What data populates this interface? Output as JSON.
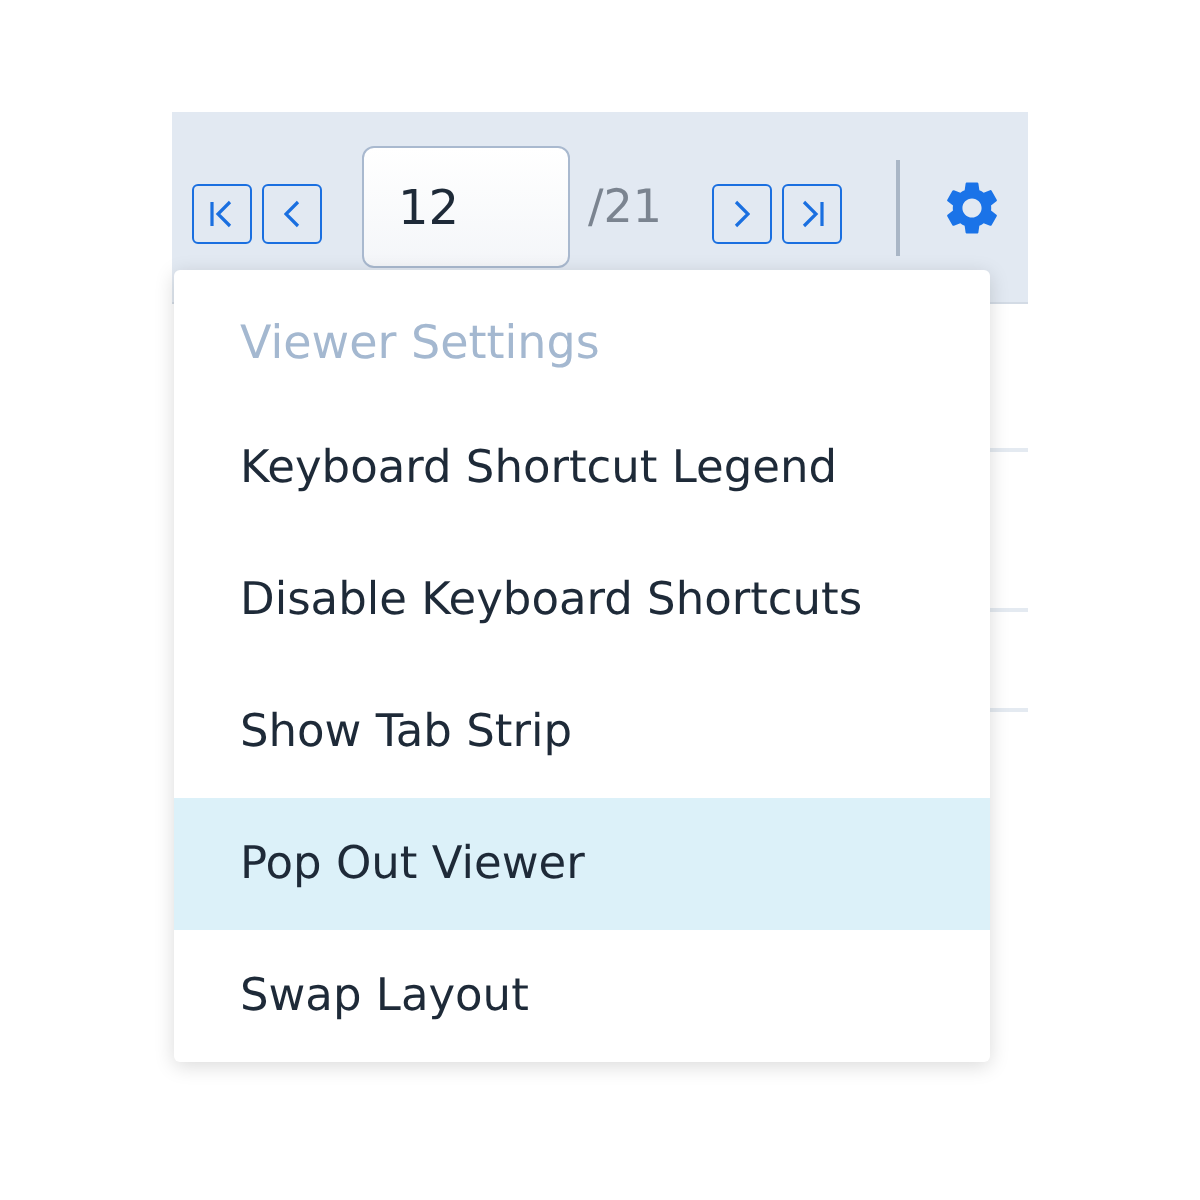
{
  "toolbar": {
    "page_number": "12",
    "page_total": "/21"
  },
  "settings_menu": {
    "header": "Viewer Settings",
    "items": [
      {
        "label": "Keyboard Shortcut Legend",
        "selected": false
      },
      {
        "label": "Disable Keyboard Shortcuts",
        "selected": false
      },
      {
        "label": "Show Tab Strip",
        "selected": false
      },
      {
        "label": "Pop Out Viewer",
        "selected": true
      },
      {
        "label": "Swap Layout",
        "selected": false
      }
    ]
  }
}
